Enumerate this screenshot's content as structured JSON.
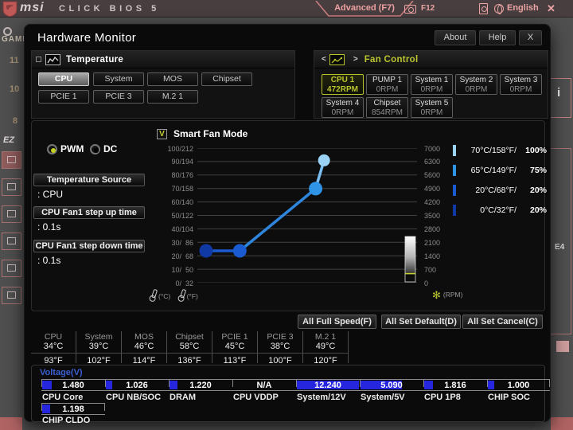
{
  "topbar": {
    "brand": "msi",
    "product": "CLICK BIOS 5",
    "mode": "Advanced (F7)",
    "hotkey": "F12",
    "language": "English",
    "close": "✕"
  },
  "background": {
    "game": "GAMI",
    "numbers": [
      "11",
      "10",
      "8"
    ],
    "ez": "EZ",
    "info": "i",
    "right_tag": "E4"
  },
  "window": {
    "title": "Hardware Monitor",
    "about": "About",
    "help": "Help",
    "close": "X"
  },
  "temperature_panel": {
    "title": "Temperature",
    "buttons": [
      {
        "label": "CPU",
        "selected": true
      },
      {
        "label": "System",
        "selected": false
      },
      {
        "label": "MOS",
        "selected": false
      },
      {
        "label": "Chipset",
        "selected": false
      },
      {
        "label": "PCIE 1",
        "selected": false
      },
      {
        "label": "PCIE 3",
        "selected": false
      },
      {
        "label": "M.2 1",
        "selected": false
      }
    ]
  },
  "fan_panel": {
    "title": "Fan Control",
    "prev": "<",
    "next": ">",
    "fans": [
      {
        "name": "CPU 1",
        "rpm": "472RPM",
        "selected": true
      },
      {
        "name": "PUMP 1",
        "rpm": "0RPM",
        "selected": false
      },
      {
        "name": "System 1",
        "rpm": "0RPM",
        "selected": false
      },
      {
        "name": "System 2",
        "rpm": "0RPM",
        "selected": false
      },
      {
        "name": "System 3",
        "rpm": "0RPM",
        "selected": false
      },
      {
        "name": "System 4",
        "rpm": "0RPM",
        "selected": false
      },
      {
        "name": "Chipset",
        "rpm": "854RPM",
        "selected": false
      },
      {
        "name": "System 5",
        "rpm": "0RPM",
        "selected": false
      }
    ]
  },
  "controls": {
    "pwm": "PWM",
    "dc": "DC",
    "mode_selected": "PWM",
    "temp_source": {
      "label": "Temperature Source",
      "value": ": CPU"
    },
    "step_up": {
      "label": "CPU Fan1 step up time",
      "value": ": 0.1s"
    },
    "step_down": {
      "label": "CPU Fan1 step down time",
      "value": ": 0.1s"
    },
    "smart_fan": {
      "label": "Smart Fan Mode",
      "checked": true,
      "check_glyph": "V"
    }
  },
  "chart_data": {
    "type": "line",
    "title": "Smart Fan Mode curve",
    "xlabel": "temperature (0-120 °C, unlabeled)",
    "ylabel_left": "temperature °C/°F",
    "ylabel_right": "fan speed RPM",
    "x_range": [
      0,
      120
    ],
    "duty_range": [
      0,
      100
    ],
    "points": [
      {
        "temp_c": 0,
        "duty_percent": 20
      },
      {
        "temp_c": 20,
        "duty_percent": 20
      },
      {
        "temp_c": 65,
        "duty_percent": 75
      },
      {
        "temp_c": 70,
        "duty_percent": 100
      }
    ],
    "point_colors": [
      "#1139a6",
      "#1b5bd2",
      "#2f93e6",
      "#9bd3f6"
    ],
    "segment_colors": [
      "#1b5bd2",
      "#2e86dc",
      "#7abdf0"
    ],
    "left_axis_labels": [
      "100/212",
      "90/194",
      "80/176",
      "70/158",
      "60/140",
      "50/122",
      "40/104",
      "30/  86",
      "20/  68",
      "10/  50",
      "0/  32"
    ],
    "right_axis_labels": [
      "7000",
      "6300",
      "5600",
      "4900",
      "4200",
      "3500",
      "2800",
      "2100",
      "1400",
      "700",
      "0"
    ],
    "legend": [
      {
        "color": "#9bd3f6",
        "label": "70°C/158°F/",
        "value": "100%"
      },
      {
        "color": "#2f93e6",
        "label": "65°C/149°F/",
        "value": "75%"
      },
      {
        "color": "#1b5bd2",
        "label": "20°C/68°F/",
        "value": "20%"
      },
      {
        "color": "#1139a6",
        "label": "0°C/32°F/",
        "value": "20%"
      }
    ],
    "current_rpm": 472,
    "rpm_max": 7000,
    "unit_c": "(°C)",
    "unit_f": "(°F)",
    "unit_rpm": "(RPM)",
    "grid": true,
    "legend_position": "right"
  },
  "actions": [
    "All Full Speed(F)",
    "All Set Default(D)",
    "All Set Cancel(C)"
  ],
  "temps": [
    {
      "name": "CPU",
      "c": "34°C",
      "f": "93°F"
    },
    {
      "name": "System",
      "c": "39°C",
      "f": "102°F"
    },
    {
      "name": "MOS",
      "c": "46°C",
      "f": "114°F"
    },
    {
      "name": "Chipset",
      "c": "58°C",
      "f": "136°F"
    },
    {
      "name": "PCIE 1",
      "c": "45°C",
      "f": "113°F"
    },
    {
      "name": "PCIE 3",
      "c": "38°C",
      "f": "100°F"
    },
    {
      "name": "M.2 1",
      "c": "49°C",
      "f": "120°F"
    }
  ],
  "voltage": {
    "title": "Voltage(V)",
    "accent": "#2626de",
    "items": [
      {
        "name": "CPU Core",
        "value": "1.480",
        "fill": 0.15
      },
      {
        "name": "CPU NB/SOC",
        "value": "1.026",
        "fill": 0.1
      },
      {
        "name": "DRAM",
        "value": "1.220",
        "fill": 0.12
      },
      {
        "name": "CPU VDDP",
        "value": "N/A",
        "fill": 0
      },
      {
        "name": "System/12V",
        "value": "12.240",
        "fill": 0.97
      },
      {
        "name": "System/5V",
        "value": "5.090",
        "fill": 0.65
      },
      {
        "name": "CPU 1P8",
        "value": "1.816",
        "fill": 0.14
      },
      {
        "name": "CHIP SOC",
        "value": "1.000",
        "fill": 0.1
      },
      {
        "name": "CHIP CLDO",
        "value": "1.198",
        "fill": 0.12
      }
    ]
  }
}
